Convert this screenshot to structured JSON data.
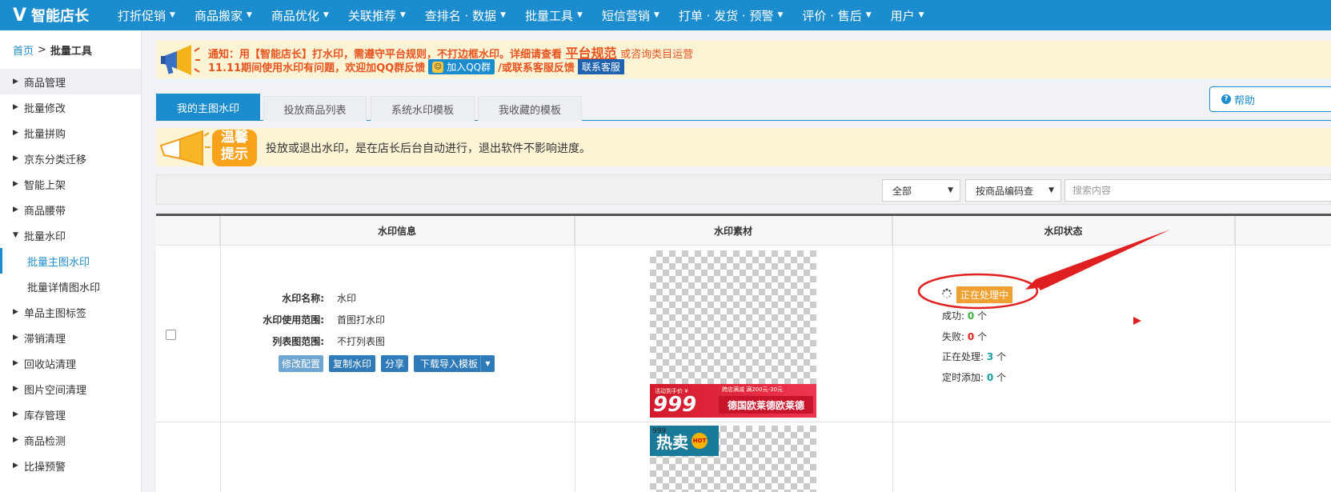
{
  "brand": {
    "logo_mark": "V",
    "name": "智能店长"
  },
  "nav": [
    {
      "label": "打折促销"
    },
    {
      "label": "商品搬家"
    },
    {
      "label": "商品优化"
    },
    {
      "label": "关联推荐"
    },
    {
      "label": "查排名 · 数据"
    },
    {
      "label": "批量工具"
    },
    {
      "label": "短信营销"
    },
    {
      "label": "打单 · 发货 · 预警"
    },
    {
      "label": "评价 · 售后"
    },
    {
      "label": "用户"
    }
  ],
  "breadcrumb": {
    "home": "首页",
    "sep": ">",
    "current": "批量工具"
  },
  "sidebar": [
    {
      "label": "商品管理",
      "tri": "▶"
    },
    {
      "label": "批量修改",
      "tri": "▶"
    },
    {
      "label": "批量拼购",
      "tri": "▶"
    },
    {
      "label": "京东分类迁移",
      "tri": "▶"
    },
    {
      "label": "智能上架",
      "tri": "▶"
    },
    {
      "label": "商品腰带",
      "tri": "▶"
    },
    {
      "label": "批量水印",
      "tri": "▼"
    },
    {
      "label": "批量主图水印",
      "tri": ""
    },
    {
      "label": "批量详情图水印",
      "tri": ""
    },
    {
      "label": "单品主图标签",
      "tri": "▶"
    },
    {
      "label": "滞销清理",
      "tri": "▶"
    },
    {
      "label": "回收站清理",
      "tri": "▶"
    },
    {
      "label": "图片空间清理",
      "tri": "▶"
    },
    {
      "label": "库存管理",
      "tri": "▶"
    },
    {
      "label": "商品检测",
      "tri": "▶"
    },
    {
      "label": "比操预警",
      "tri": "▶"
    }
  ],
  "notice": {
    "line1_prefix": "通知：用【智能店长】打水印，需遵守平台规则，不打边框水印。详细请查看",
    "line1_link": "平台规范",
    "line1_suffix": "或咨询类目运营",
    "line2_prefix": "11.11期间使用水印有问题，欢迎加QQ群反馈",
    "qq_button": "加入QQ群",
    "line2_mid": "/或联系客服反馈",
    "service_button": "联系客服"
  },
  "help_button": "帮助",
  "tabs": [
    {
      "label": "我的主图水印"
    },
    {
      "label": "投放商品列表"
    },
    {
      "label": "系统水印模板"
    },
    {
      "label": "我收藏的模板"
    }
  ],
  "tip": {
    "badge_l1": "温馨",
    "badge_l2": "提示",
    "text": "投放或退出水印，是在店长后台自动进行，退出软件不影响进度。"
  },
  "filters": {
    "status_select": "全部",
    "search_mode_select": "按商品编码查",
    "search_placeholder": "搜索内容"
  },
  "table": {
    "headers": [
      "水印信息",
      "水印素材",
      "水印状态"
    ],
    "row1": {
      "info": [
        {
          "key": "水印名称:",
          "value": "水印"
        },
        {
          "key": "水印使用范围:",
          "value": "首图打水印"
        },
        {
          "key": "列表图范围:",
          "value": "不打列表图"
        }
      ],
      "buttons": {
        "edit": "修改配置",
        "copy": "复制水印",
        "share": "分享",
        "download": "下载导入模板"
      },
      "material": {
        "small_left": "活动到手价 ¥",
        "small_right": "跨店满减 满200元-30元",
        "price": "999",
        "brand_text": "德国欧莱德欧莱德"
      },
      "status": {
        "badge": "正在处理中",
        "success_label": "成功:",
        "success_value": "0",
        "fail_label": "失败:",
        "fail_value": "0",
        "processing_label": "正在处理:",
        "processing_value": "3",
        "scheduled_label": "定时添加:",
        "scheduled_value": "0",
        "unit": "个"
      }
    },
    "row2": {
      "material": {
        "tiny": "999",
        "hot_text": "热卖",
        "hot_badge": "HOT"
      }
    }
  },
  "colors": {
    "accent": "#1b8ccd",
    "notice_text": "#e8531f",
    "annotation": "#e02020",
    "processing_badge": "#f0a030"
  }
}
